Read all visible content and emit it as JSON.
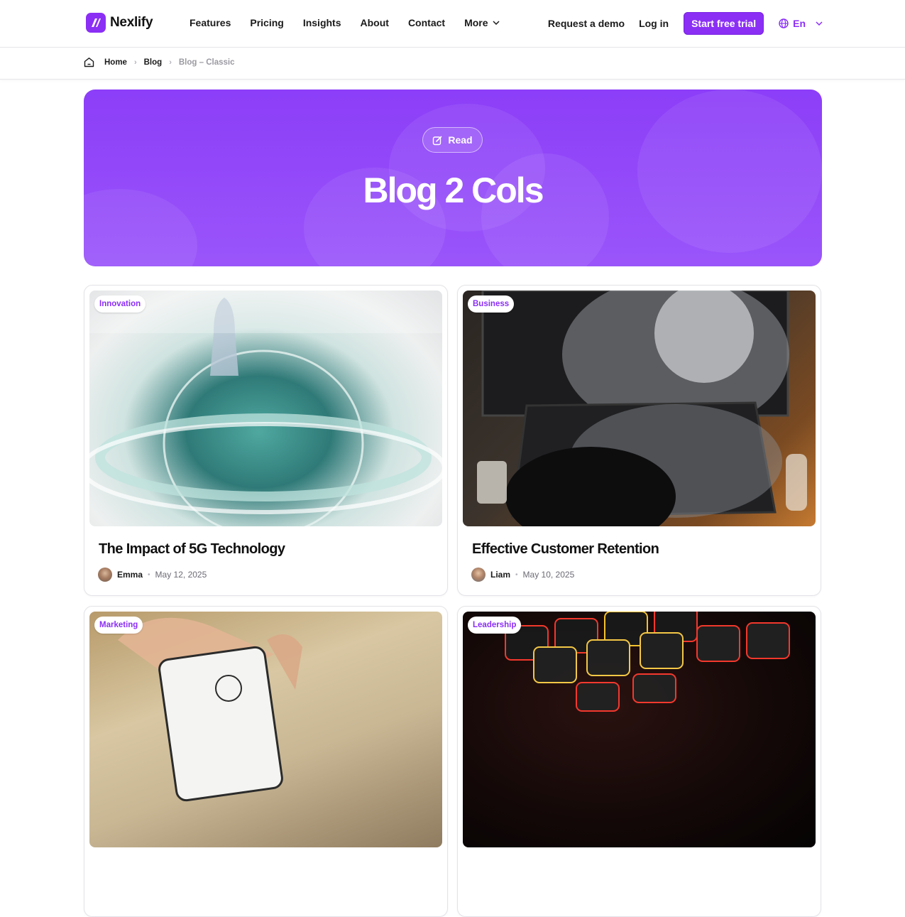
{
  "nav": {
    "brand": "Nexlify",
    "items": [
      {
        "label": "Features"
      },
      {
        "label": "Pricing"
      },
      {
        "label": "Insights"
      },
      {
        "label": "About"
      },
      {
        "label": "Contact"
      },
      {
        "label": "More"
      }
    ],
    "request_demo": "Request a demo",
    "login": "Log in",
    "cta": "Start free trial",
    "language": "En"
  },
  "breadcrumb": [
    "Home",
    "Blog",
    "Blog – Classic"
  ],
  "hero": {
    "pill_label": "Read",
    "title": "Blog 2 Cols"
  },
  "posts": [
    {
      "category": "Innovation",
      "title": "The Impact of 5G Technology",
      "author": "Emma",
      "date": "May 12, 2025"
    },
    {
      "category": "Business",
      "title": "Effective Customer Retention",
      "author": "Liam",
      "date": "May 10, 2025"
    },
    {
      "category": "Marketing",
      "title": "",
      "author": "",
      "date": ""
    },
    {
      "category": "Leadership",
      "title": "",
      "author": "",
      "date": ""
    }
  ],
  "colors": {
    "brand": "#8b2ff5",
    "hero_top": "#8c3ef8",
    "hero_bottom": "#9a55fa",
    "text": "#111111",
    "muted": "#9a9aa2"
  }
}
